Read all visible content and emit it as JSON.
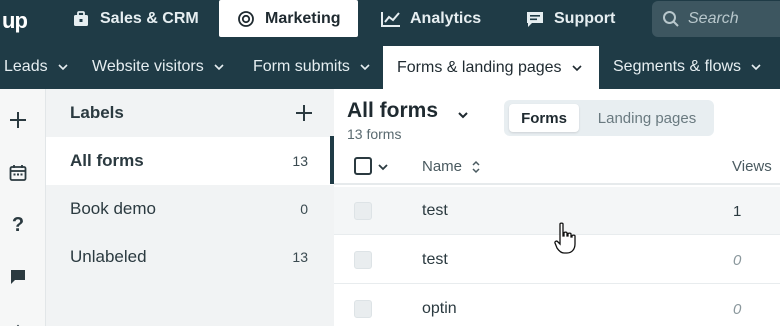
{
  "brand": {
    "logo_text": "up"
  },
  "topnav": {
    "items": [
      {
        "label": "Sales & CRM",
        "icon": "briefcase-icon",
        "active": false
      },
      {
        "label": "Marketing",
        "icon": "target-icon",
        "active": true
      },
      {
        "label": "Analytics",
        "icon": "chart-line-icon",
        "active": false
      },
      {
        "label": "Support",
        "icon": "chat-bubble-icon",
        "active": false
      }
    ],
    "search": {
      "placeholder": "Search",
      "icon": "search-icon"
    }
  },
  "subnav": {
    "items": [
      {
        "label": "Leads",
        "active": false
      },
      {
        "label": "Website visitors",
        "active": false
      },
      {
        "label": "Form submits",
        "active": false
      },
      {
        "label": "Forms & landing pages",
        "active": true
      },
      {
        "label": "Segments & flows",
        "active": false
      }
    ]
  },
  "rail": {
    "icons": [
      "plus-icon",
      "calendar-icon",
      "help-icon",
      "chat-icon"
    ]
  },
  "labels": {
    "title": "Labels",
    "add_icon": "plus-icon",
    "items": [
      {
        "label": "All forms",
        "count": "13",
        "selected": true
      },
      {
        "label": "Book demo",
        "count": "0",
        "selected": false
      },
      {
        "label": "Unlabeled",
        "count": "13",
        "selected": false
      }
    ]
  },
  "main": {
    "title": "All forms",
    "subtitle": "13 forms",
    "toggle": {
      "options": [
        "Forms",
        "Landing pages"
      ],
      "selected": "Forms"
    },
    "table": {
      "columns": {
        "name": "Name",
        "views": "Views"
      },
      "rows": [
        {
          "name": "test",
          "views": "1"
        },
        {
          "name": "test",
          "views": "0"
        },
        {
          "name": "optin",
          "views": "0"
        }
      ]
    }
  },
  "colors": {
    "header_bg": "#1f3b46",
    "panel_bg": "#f1f3f4",
    "toggle_bg": "#e8eef1"
  }
}
